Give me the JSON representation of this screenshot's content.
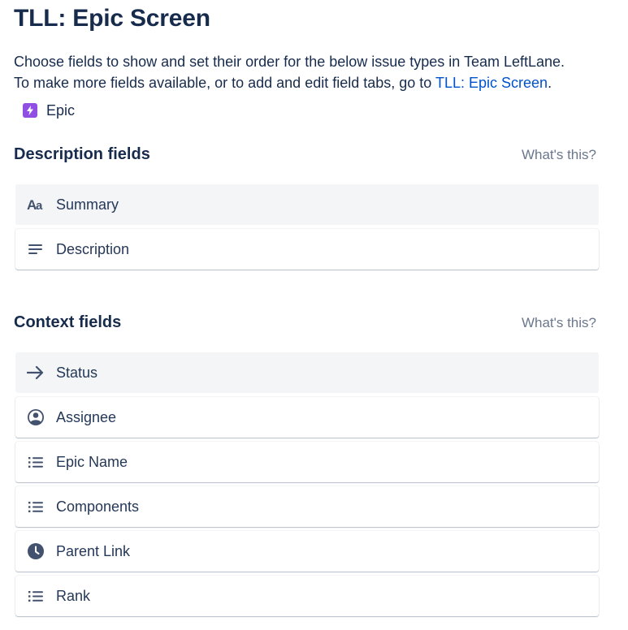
{
  "page": {
    "title": "TLL: Epic Screen",
    "description_line1": "Choose fields to show and set their order for the below issue types in Team LeftLane.",
    "description_line2_prefix": "To make more fields available, or to add and edit field tabs, go to ",
    "description_link": "TLL: Epic Screen",
    "description_line2_suffix": "."
  },
  "issue_type": {
    "label": "Epic",
    "icon": "lightning-bolt-icon",
    "color": "#904EE2"
  },
  "description_section": {
    "title": "Description fields",
    "help": "What's this?",
    "fields": [
      {
        "label": "Summary",
        "icon": "text-aa-icon",
        "locked": true
      },
      {
        "label": "Description",
        "icon": "paragraph-lines-icon",
        "locked": false
      }
    ]
  },
  "context_section": {
    "title": "Context fields",
    "help": "What's this?",
    "fields": [
      {
        "label": "Status",
        "icon": "arrow-right-icon",
        "locked": true
      },
      {
        "label": "Assignee",
        "icon": "user-avatar-icon",
        "locked": false
      },
      {
        "label": "Epic Name",
        "icon": "bulleted-list-icon",
        "locked": false
      },
      {
        "label": "Components",
        "icon": "bulleted-list-icon",
        "locked": false
      },
      {
        "label": "Parent Link",
        "icon": "clock-icon",
        "locked": false
      },
      {
        "label": "Rank",
        "icon": "bulleted-list-icon",
        "locked": false
      }
    ]
  },
  "colors": {
    "text": "#172B4D",
    "link": "#0052CC",
    "muted": "#6B778C",
    "locked_bg": "#F4F5F7"
  }
}
